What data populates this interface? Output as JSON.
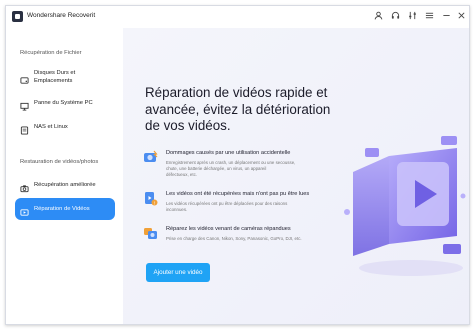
{
  "app": {
    "title": "Wondershare Recoverit"
  },
  "titlebar": {
    "icons": [
      "user-icon",
      "headset-icon",
      "sliders-icon",
      "menu-icon",
      "minimize-icon",
      "close-icon"
    ]
  },
  "sidebar": {
    "section1": "Récupération de Fichier",
    "items1": [
      {
        "label_line1": "Disques Durs et",
        "label_line2": "Emplacements",
        "icon": "hard-drive-icon"
      },
      {
        "label_line1": "Panne du Système PC",
        "icon": "monitor-icon"
      },
      {
        "label_line1": "NAS et Linux",
        "icon": "nas-icon"
      }
    ],
    "section2": "Restauration de vidéos/photos",
    "items2": [
      {
        "label_line1": "Récupération améliorée",
        "icon": "camera-icon"
      },
      {
        "label_line1": "Réparation de Vidéos",
        "icon": "video-icon",
        "active": true
      }
    ]
  },
  "main": {
    "title_lines": [
      "Réparation de vidéos rapide et",
      "avancée, évitez la détérioration",
      "de vos vidéos."
    ],
    "features": [
      {
        "title": "Dommages causés par une utilisation accidentelle",
        "desc_lines": [
          "Enregistrement après un crash, un déplacement ou une secousse,",
          "chute, une batterie déchargée, un virus, un appareil",
          "défectueux, etc."
        ]
      },
      {
        "title": "Les vidéos ont été récupérées mais n'ont pas pu être lues",
        "desc_lines": [
          "Les vidéos récupérées ont pu être déplacées pour des raisons",
          "inconnues."
        ]
      },
      {
        "title": "Réparez les vidéos venant de caméras répandues",
        "desc_lines": [
          "Prise en charge des Canon, Nikon, Sony, Panasonic, GoPro, DJI, etc."
        ]
      }
    ],
    "add_button": "Ajouter une vidéo"
  },
  "colors": {
    "accent": "#2d8cf5",
    "button": "#1fa3f5",
    "illustration": "#8c80f0"
  }
}
